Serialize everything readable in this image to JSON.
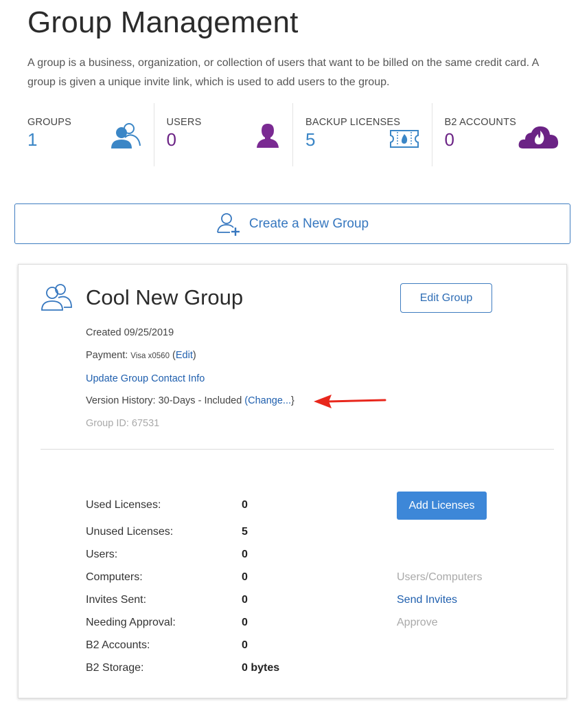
{
  "page": {
    "title": "Group Management",
    "intro": "A group is a business, organization, or collection of users that want to be billed on the same credit card. A group is given a unique invite link, which is used to add users to the group."
  },
  "stats": [
    {
      "label": "GROUPS",
      "value": "1",
      "icon": "group-users-icon",
      "color": "#3b86c6"
    },
    {
      "label": "USERS",
      "value": "0",
      "icon": "user-silhouette-icon",
      "color": "#6b2385"
    },
    {
      "label": "BACKUP LICENSES",
      "value": "5",
      "icon": "license-ticket-icon",
      "color": "#3b86c6"
    },
    {
      "label": "B2 ACCOUNTS",
      "value": "0",
      "icon": "b2-cloud-flame-icon",
      "color": "#6b2385"
    }
  ],
  "create_group": {
    "label": "Create a New Group",
    "icon": "add-user-icon"
  },
  "group": {
    "name": "Cool New Group",
    "edit_label": "Edit Group",
    "created": "Created 09/25/2019",
    "payment_label": "Payment:",
    "payment_card": "Visa x0560",
    "payment_open": "(",
    "payment_edit": "Edit",
    "payment_close": ")",
    "update_contact": "Update Group Contact Info",
    "version_label": "Version History: 30-Days - Included",
    "version_change": "(Change...",
    "version_close": "}",
    "group_id": "Group ID: 67531"
  },
  "licenses": {
    "rows": [
      {
        "label": "Used Licenses:",
        "value": "0"
      },
      {
        "label": "Unused Licenses:",
        "value": "5"
      },
      {
        "label": "Users:",
        "value": "0"
      },
      {
        "label": "Computers:",
        "value": "0"
      },
      {
        "label": "Invites Sent:",
        "value": "0"
      },
      {
        "label": "Needing Approval:",
        "value": "0"
      },
      {
        "label": "B2 Accounts:",
        "value": "0"
      },
      {
        "label": "B2 Storage:",
        "value": "0 bytes"
      }
    ],
    "add_label": "Add Licenses",
    "users_computers": "Users/Computers",
    "send_invites": "Send Invites",
    "approve": "Approve"
  },
  "colors": {
    "accent": "#3677bf",
    "purple": "#6b2385",
    "arrow": "#e8271c",
    "button": "#3d87d8"
  }
}
